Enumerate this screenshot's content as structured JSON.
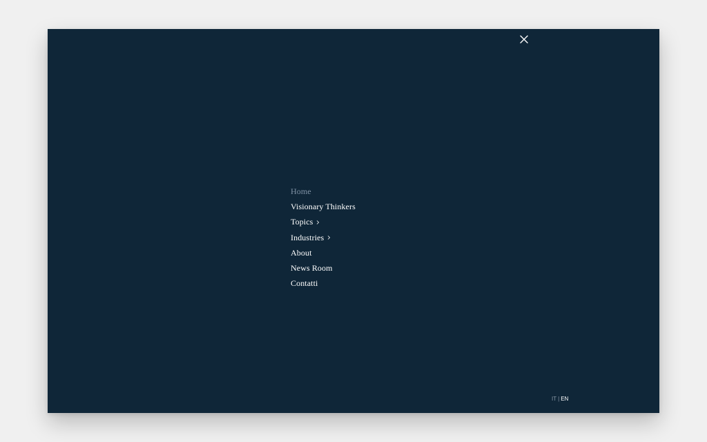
{
  "menu": {
    "items": [
      {
        "label": "Home",
        "active": true
      },
      {
        "label": "Visionary Thinkers"
      },
      {
        "label": "Topics",
        "submenu": true
      },
      {
        "label": "Industries",
        "submenu": true
      },
      {
        "label": "About"
      },
      {
        "label": "News Room"
      },
      {
        "label": "Contatti"
      }
    ]
  },
  "close": {
    "icon": "close-icon"
  },
  "language": {
    "options": [
      "IT",
      "EN"
    ],
    "separator": "|",
    "selected": "EN"
  },
  "colors": {
    "background": "#0f2638",
    "active_item": "#8193a6",
    "text": "#ffffff"
  }
}
